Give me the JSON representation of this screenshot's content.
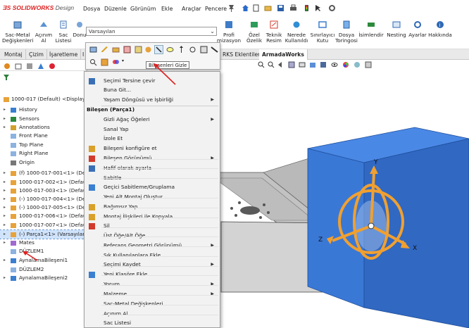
{
  "app": {
    "logo_brand": "SOLIDWORKS",
    "logo_suffix": "Design"
  },
  "menubar": {
    "items": [
      "Dosya",
      "Düzenle",
      "Görünüm",
      "Ekle",
      "Araçlar",
      "Pencere"
    ]
  },
  "ribbon": {
    "buttons": [
      {
        "label1": "Sac-Metal",
        "label2": "Değişkenleri"
      },
      {
        "label1": "Açınım",
        "label2": "Al"
      },
      {
        "label1": "Sac",
        "label2": "Listesi"
      },
      {
        "label1": "Donu",
        "label2": ""
      },
      {
        "label1": "Profi",
        "label2": "mizasyon"
      },
      {
        "label1": "Özel",
        "label2": "Özelik"
      },
      {
        "label1": "Teknik",
        "label2": "Resim"
      },
      {
        "label1": "Nerede",
        "label2": "Kullanıldı"
      },
      {
        "label1": "Sınırlayıcı",
        "label2": "Kutu"
      },
      {
        "label1": "Dosya",
        "label2": "Toringosi"
      },
      {
        "label1": "İsimlendir",
        "label2": ""
      },
      {
        "label1": "Nesting",
        "label2": ""
      },
      {
        "label1": "Ayarlar",
        "label2": ""
      },
      {
        "label1": "Hakkında",
        "label2": ""
      }
    ]
  },
  "config_combo": {
    "value": "Varsayılan"
  },
  "tabs": [
    "Montaj",
    "Çizim",
    "İşaretleme",
    "I",
    "RKS Eklentileri",
    "ArmadaWorks"
  ],
  "tooltip": "Bileşenleri Gizle",
  "tree": {
    "root": "1000-017 (Default) <Display S",
    "items": [
      "History",
      "Sensors",
      "Annotations",
      "Front Plane",
      "Top Plane",
      "Right Plane",
      "Origin",
      "(f) 1000-017-001<1> (Def",
      "1000-017-002<1> (Defau",
      "1000-017-003<1> (Defau",
      "(-) 1000-017-004<1> (Def",
      "(-) 1000-017-005<1> (Def",
      "1000-017-006<1> (Defau",
      "1000-017-007<1> (Defau",
      "(-) Parça1<1> (Varsayılan)",
      "Mates",
      "DÜZLEM1",
      "AynalamaBileşeni1",
      "DÜZLEM2",
      "AynalamaBileşeni2"
    ]
  },
  "context_menu": {
    "top_items": [
      "Seçimi Tersine çevir",
      "Buna Git...",
      "Yaşam Döngüsü ve İşbirliği"
    ],
    "header": "Bileşen (Parça1)",
    "items": [
      "Gizli Ağaç Öğeleri",
      "Sanal Yap",
      "İzole Et",
      "Bileşeni konfigüre et",
      "Bileşen Görünümü",
      "Hafif olarak ayarla",
      "Sabitle",
      "Geçici Sabitleme/Gruplama",
      "Yeni Alt Montaj Oluştur",
      "Bağımsız Yap",
      "Montaj İlişkileri ile Kopyala",
      "Sil",
      "Üst Öğe/Alt Öğe...",
      "Referans Geometri Görünümü",
      "Sık Kullanılanlara Ekle",
      "Seçimi Kaydet",
      "Yeni Klasöre Ekle",
      "Yorum",
      "Malzeme",
      "Sac-Metal Değişkenleri",
      "Açınım Al",
      "Sac Listesi"
    ]
  },
  "triad": {
    "x_label": "X",
    "y_label": "Y",
    "z_label": "Z"
  },
  "colors": {
    "accent": "#1f6fd1",
    "triad": "#f0a030",
    "panel_blue": "#3a78d6",
    "arrow": "#e02020"
  }
}
